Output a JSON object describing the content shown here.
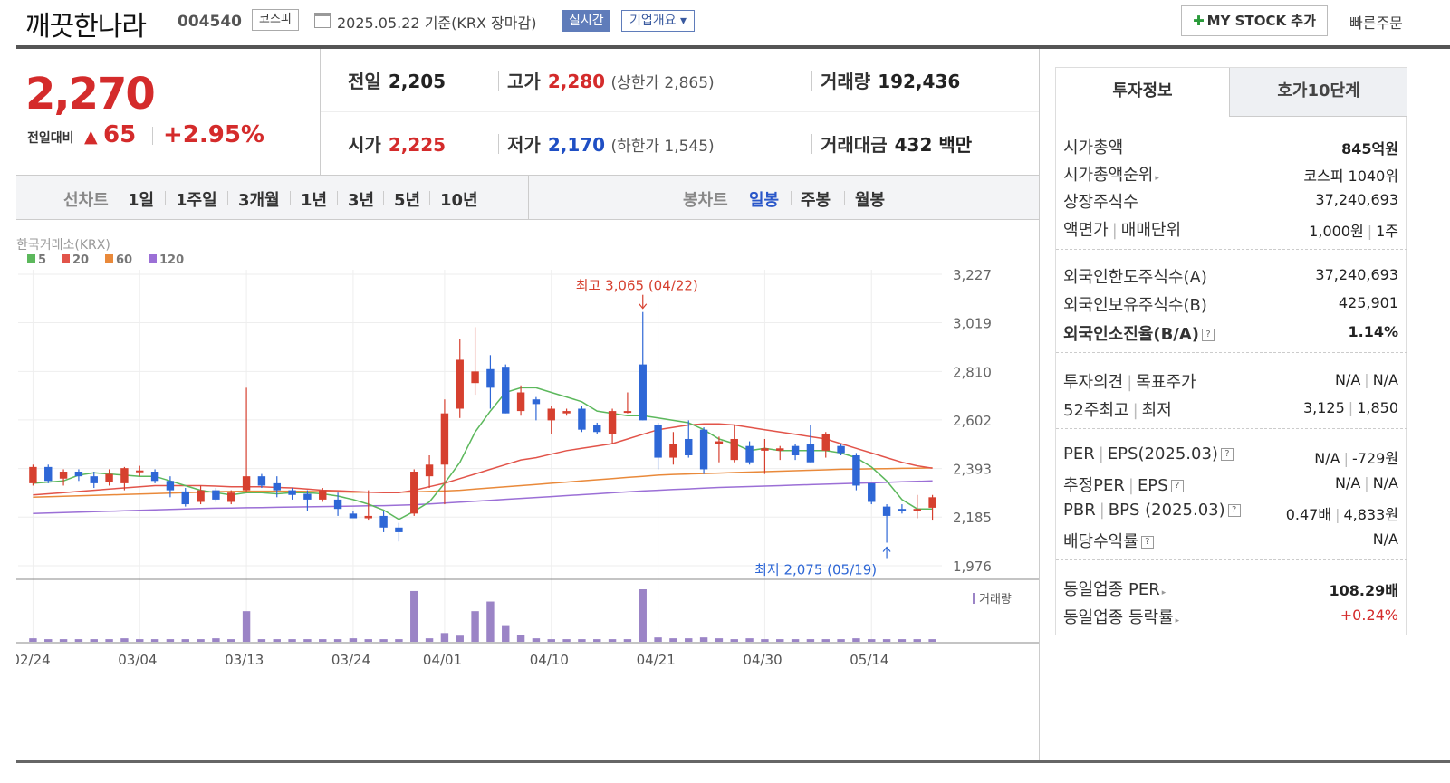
{
  "header": {
    "stock_name": "깨끗한나라",
    "stock_code": "004540",
    "market": "코스피",
    "basis_date": "2025.05.22  기준(KRX 장마감)",
    "realtime_label": "실시간",
    "overview_label": "기업개요 ▾",
    "mystock_label": "MY STOCK 추가",
    "quick_order_label": "빠른주문"
  },
  "price": {
    "current": "2,270",
    "prev_label": "전일대비",
    "change": "65",
    "rate": "+2.95%"
  },
  "stats": {
    "prev_close_label": "전일",
    "prev_close": "2,205",
    "high_label": "고가",
    "high": "2,280",
    "upper_limit": "(상한가 2,865)",
    "volume_label": "거래량",
    "volume": "192,436",
    "open_label": "시가",
    "open": "2,225",
    "low_label": "저가",
    "low": "2,170",
    "lower_limit": "(하한가 1,545)",
    "amount_label": "거래대금",
    "amount": "432 백만"
  },
  "period_bar": {
    "line_label": "선차트",
    "periods": [
      "1일",
      "1주일",
      "3개월",
      "1년",
      "3년",
      "5년",
      "10년"
    ],
    "candle_label": "봉차트",
    "candle_periods": [
      "일봉",
      "주봉",
      "월봉"
    ],
    "active_candle": "일봉"
  },
  "chart_data": {
    "type": "candlestick",
    "source_label": "한국거래소(KRX)",
    "legend": [
      {
        "name": "5",
        "color": "#5cb85c"
      },
      {
        "name": "20",
        "color": "#e2544a"
      },
      {
        "name": "60",
        "color": "#e9893a"
      },
      {
        "name": "120",
        "color": "#9b6fd6"
      }
    ],
    "y_ticks": [
      "3,227",
      "3,019",
      "2,810",
      "2,602",
      "2,393",
      "2,185",
      "1,976"
    ],
    "ylim": [
      1976,
      3227
    ],
    "x_ticks": [
      "02/24",
      "03/04",
      "03/13",
      "03/24",
      "04/01",
      "04/10",
      "04/21",
      "04/30",
      "05/14"
    ],
    "high_annotation": "최고 3,065 (04/22)",
    "low_annotation": "최저 2,075 (05/19)",
    "volume_label": "거래량",
    "candles": [
      {
        "o": 2330,
        "h": 2410,
        "l": 2320,
        "c": 2400
      },
      {
        "o": 2400,
        "h": 2410,
        "l": 2330,
        "c": 2340
      },
      {
        "o": 2350,
        "h": 2390,
        "l": 2320,
        "c": 2380
      },
      {
        "o": 2380,
        "h": 2390,
        "l": 2340,
        "c": 2360
      },
      {
        "o": 2360,
        "h": 2380,
        "l": 2310,
        "c": 2330
      },
      {
        "o": 2335,
        "h": 2390,
        "l": 2320,
        "c": 2370
      },
      {
        "o": 2330,
        "h": 2400,
        "l": 2300,
        "c": 2395
      },
      {
        "o": 2380,
        "h": 2405,
        "l": 2360,
        "c": 2385
      },
      {
        "o": 2380,
        "h": 2390,
        "l": 2330,
        "c": 2340
      },
      {
        "o": 2340,
        "h": 2360,
        "l": 2270,
        "c": 2300
      },
      {
        "o": 2295,
        "h": 2310,
        "l": 2230,
        "c": 2240
      },
      {
        "o": 2250,
        "h": 2320,
        "l": 2240,
        "c": 2300
      },
      {
        "o": 2300,
        "h": 2310,
        "l": 2250,
        "c": 2260
      },
      {
        "o": 2250,
        "h": 2300,
        "l": 2240,
        "c": 2290
      },
      {
        "o": 2300,
        "h": 2740,
        "l": 2290,
        "c": 2360
      },
      {
        "o": 2360,
        "h": 2370,
        "l": 2310,
        "c": 2320
      },
      {
        "o": 2330,
        "h": 2360,
        "l": 2270,
        "c": 2300
      },
      {
        "o": 2300,
        "h": 2310,
        "l": 2260,
        "c": 2280
      },
      {
        "o": 2285,
        "h": 2300,
        "l": 2210,
        "c": 2260
      },
      {
        "o": 2260,
        "h": 2310,
        "l": 2250,
        "c": 2300
      },
      {
        "o": 2260,
        "h": 2290,
        "l": 2190,
        "c": 2220
      },
      {
        "o": 2200,
        "h": 2210,
        "l": 2180,
        "c": 2180
      },
      {
        "o": 2180,
        "h": 2300,
        "l": 2170,
        "c": 2190
      },
      {
        "o": 2190,
        "h": 2210,
        "l": 2120,
        "c": 2140
      },
      {
        "o": 2140,
        "h": 2160,
        "l": 2080,
        "c": 2120
      },
      {
        "o": 2200,
        "h": 2390,
        "l": 2190,
        "c": 2380
      },
      {
        "o": 2360,
        "h": 2450,
        "l": 2310,
        "c": 2410
      },
      {
        "o": 2410,
        "h": 2690,
        "l": 2240,
        "c": 2630
      },
      {
        "o": 2650,
        "h": 2950,
        "l": 2610,
        "c": 2860
      },
      {
        "o": 2760,
        "h": 3000,
        "l": 2710,
        "c": 2810
      },
      {
        "o": 2820,
        "h": 2880,
        "l": 2650,
        "c": 2740
      },
      {
        "o": 2830,
        "h": 2840,
        "l": 2630,
        "c": 2630
      },
      {
        "o": 2640,
        "h": 2750,
        "l": 2620,
        "c": 2720
      },
      {
        "o": 2690,
        "h": 2700,
        "l": 2600,
        "c": 2670
      },
      {
        "o": 2600,
        "h": 2660,
        "l": 2540,
        "c": 2650
      },
      {
        "o": 2630,
        "h": 2650,
        "l": 2620,
        "c": 2640
      },
      {
        "o": 2650,
        "h": 2660,
        "l": 2550,
        "c": 2560
      },
      {
        "o": 2580,
        "h": 2590,
        "l": 2540,
        "c": 2550
      },
      {
        "o": 2540,
        "h": 2650,
        "l": 2500,
        "c": 2640
      },
      {
        "o": 2640,
        "h": 2720,
        "l": 2630,
        "c": 2640
      },
      {
        "o": 2840,
        "h": 3065,
        "l": 2600,
        "c": 2600
      },
      {
        "o": 2580,
        "h": 2590,
        "l": 2390,
        "c": 2440
      },
      {
        "o": 2440,
        "h": 2550,
        "l": 2410,
        "c": 2500
      },
      {
        "o": 2520,
        "h": 2600,
        "l": 2440,
        "c": 2450
      },
      {
        "o": 2560,
        "h": 2570,
        "l": 2370,
        "c": 2390
      },
      {
        "o": 2500,
        "h": 2530,
        "l": 2420,
        "c": 2510
      },
      {
        "o": 2430,
        "h": 2580,
        "l": 2420,
        "c": 2520
      },
      {
        "o": 2490,
        "h": 2510,
        "l": 2410,
        "c": 2420
      },
      {
        "o": 2470,
        "h": 2520,
        "l": 2370,
        "c": 2480
      },
      {
        "o": 2470,
        "h": 2490,
        "l": 2430,
        "c": 2480
      },
      {
        "o": 2490,
        "h": 2500,
        "l": 2430,
        "c": 2450
      },
      {
        "o": 2500,
        "h": 2580,
        "l": 2420,
        "c": 2420
      },
      {
        "o": 2470,
        "h": 2550,
        "l": 2440,
        "c": 2540
      },
      {
        "o": 2490,
        "h": 2500,
        "l": 2450,
        "c": 2460
      },
      {
        "o": 2450,
        "h": 2460,
        "l": 2300,
        "c": 2320
      },
      {
        "o": 2330,
        "h": 2330,
        "l": 2240,
        "c": 2250
      },
      {
        "o": 2230,
        "h": 2240,
        "l": 2075,
        "c": 2190
      },
      {
        "o": 2220,
        "h": 2240,
        "l": 2200,
        "c": 2210
      },
      {
        "o": 2220,
        "h": 2280,
        "l": 2180,
        "c": 2220
      },
      {
        "o": 2225,
        "h": 2280,
        "l": 2170,
        "c": 2270
      }
    ],
    "volumes": [
      4,
      3,
      3,
      3,
      3,
      3,
      4,
      3,
      3,
      3,
      3,
      3,
      4,
      3,
      35,
      3,
      3,
      3,
      3,
      3,
      3,
      4,
      3,
      3,
      3,
      58,
      4,
      10,
      7,
      35,
      46,
      18,
      8,
      4,
      3,
      3,
      3,
      3,
      3,
      3,
      60,
      5,
      4,
      4,
      5,
      4,
      3,
      4,
      3,
      3,
      3,
      3,
      3,
      3,
      4,
      3,
      3,
      3,
      3,
      3
    ],
    "ma5": [
      2330,
      2335,
      2340,
      2365,
      2375,
      2370,
      2365,
      2360,
      2360,
      2340,
      2320,
      2300,
      2290,
      2280,
      2290,
      2290,
      2285,
      2290,
      2290,
      2285,
      2275,
      2260,
      2240,
      2215,
      2175,
      2210,
      2250,
      2330,
      2420,
      2550,
      2640,
      2720,
      2740,
      2740,
      2720,
      2700,
      2680,
      2640,
      2630,
      2620,
      2620,
      2610,
      2600,
      2590,
      2560,
      2520,
      2500,
      2470,
      2480,
      2470,
      2470,
      2470,
      2470,
      2460,
      2440,
      2400,
      2340,
      2260,
      2220,
      2220
    ],
    "ma20": [
      2280,
      2285,
      2290,
      2295,
      2300,
      2305,
      2310,
      2315,
      2320,
      2320,
      2320,
      2320,
      2318,
      2315,
      2315,
      2315,
      2312,
      2310,
      2305,
      2300,
      2298,
      2295,
      2292,
      2290,
      2290,
      2300,
      2315,
      2330,
      2350,
      2370,
      2390,
      2410,
      2430,
      2440,
      2455,
      2470,
      2480,
      2490,
      2500,
      2520,
      2540,
      2560,
      2570,
      2580,
      2585,
      2585,
      2580,
      2570,
      2560,
      2550,
      2540,
      2530,
      2520,
      2500,
      2480,
      2460,
      2440,
      2420,
      2405,
      2395
    ],
    "ma60": [
      2270,
      2272,
      2274,
      2276,
      2278,
      2280,
      2282,
      2284,
      2286,
      2288,
      2290,
      2292,
      2294,
      2295,
      2296,
      2296,
      2296,
      2296,
      2295,
      2294,
      2293,
      2292,
      2292,
      2292,
      2292,
      2293,
      2295,
      2297,
      2300,
      2305,
      2310,
      2315,
      2320,
      2325,
      2330,
      2335,
      2340,
      2345,
      2350,
      2355,
      2360,
      2365,
      2368,
      2370,
      2372,
      2374,
      2376,
      2378,
      2380,
      2382,
      2384,
      2386,
      2388,
      2390,
      2391,
      2392,
      2393,
      2394,
      2395,
      2396
    ],
    "ma120": [
      2200,
      2202,
      2204,
      2206,
      2208,
      2210,
      2212,
      2214,
      2216,
      2218,
      2220,
      2222,
      2223,
      2224,
      2225,
      2226,
      2227,
      2228,
      2229,
      2230,
      2231,
      2232,
      2233,
      2234,
      2236,
      2238,
      2241,
      2245,
      2249,
      2253,
      2257,
      2261,
      2265,
      2269,
      2273,
      2277,
      2281,
      2285,
      2289,
      2293,
      2297,
      2300,
      2303,
      2306,
      2309,
      2312,
      2314,
      2316,
      2318,
      2320,
      2322,
      2324,
      2326,
      2328,
      2330,
      2332,
      2334,
      2336,
      2338,
      2340
    ]
  },
  "right_panel": {
    "tabs": [
      "투자정보",
      "호가10단계"
    ],
    "market_cap_label": "시가총액",
    "market_cap": "845억원",
    "rank_label": "시가총액순위",
    "rank": "코스피 1040위",
    "shares_label": "상장주식수",
    "shares": "37,240,693",
    "par_label": "액면가",
    "unit_label": "매매단위",
    "par": "1,000원",
    "unit": "1주",
    "foreign_limit_label": "외국인한도주식수(A)",
    "foreign_limit": "37,240,693",
    "foreign_hold_label": "외국인보유주식수(B)",
    "foreign_hold": "425,901",
    "foreign_ratio_label": "외국인소진율(B/A)",
    "foreign_ratio": "1.14%",
    "opinion_label": "투자의견",
    "target_label": "목표주가",
    "opinion": "N/A",
    "target": "N/A",
    "w52_high_label": "52주최고",
    "w52_low_label": "최저",
    "w52_high": "3,125",
    "w52_low": "1,850",
    "per_label": "PER",
    "eps_label": "EPS(2025.03)",
    "per": "N/A",
    "eps": "-729원",
    "est_per_label": "추정PER",
    "est_eps_label": "EPS",
    "est_per": "N/A",
    "est_eps": "N/A",
    "pbr_label": "PBR",
    "bps_label": "BPS (2025.03)",
    "pbr": "0.47배",
    "bps": "4,833원",
    "div_label": "배당수익률",
    "div": "N/A",
    "sector_per_label": "동일업종 PER",
    "sector_per": "108.29배",
    "sector_rate_label": "동일업종 등락률",
    "sector_rate": "+0.24%"
  }
}
